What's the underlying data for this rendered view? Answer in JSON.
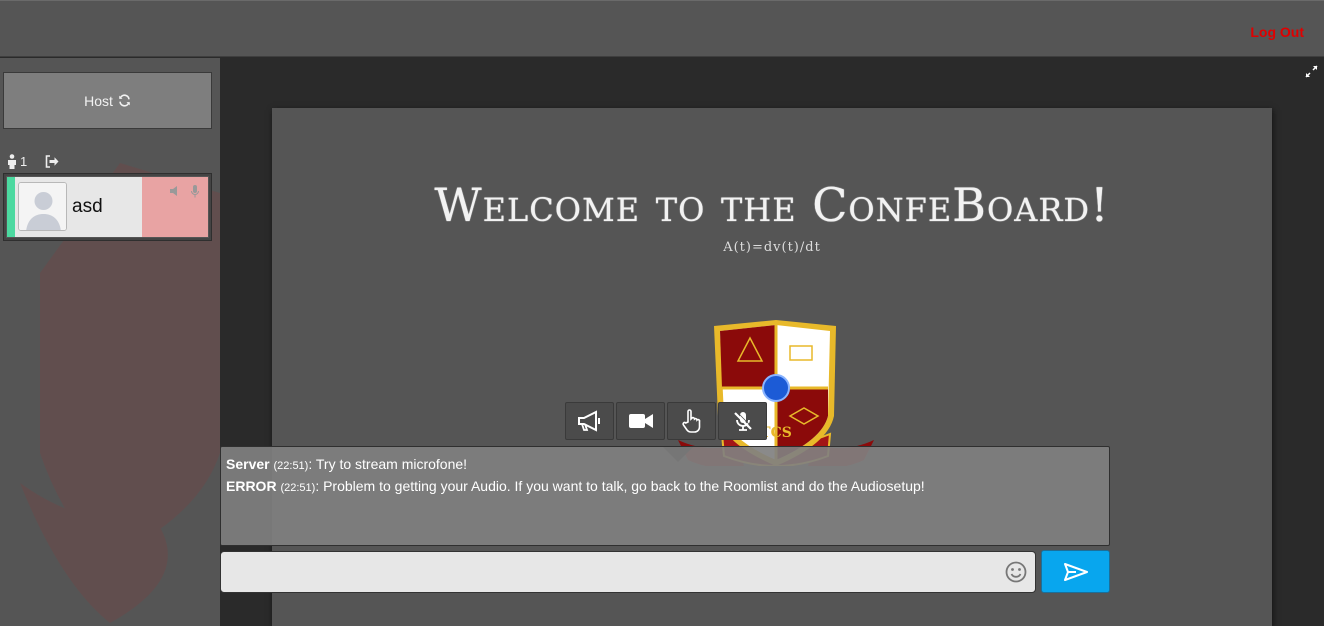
{
  "header": {
    "logout_label": "Log Out"
  },
  "sidebar": {
    "host_label": "Host",
    "user_count": "1",
    "users": [
      {
        "name": "asd",
        "status_color": "#4cd9a0",
        "media_color": "#e8a3a3"
      }
    ]
  },
  "board": {
    "title": "Welcome to the ConfeBoard!",
    "subtitle": "A(t)=dv(t)/dt",
    "logo_text": "TCS"
  },
  "toolbar": {
    "items": [
      "megaphone-icon",
      "video-camera-icon",
      "hand-pointer-icon",
      "microphone-muted-icon"
    ]
  },
  "chat": {
    "messages": [
      {
        "sender": "Server",
        "time": "(22:51)",
        "text": ": Try to stream microfone!"
      },
      {
        "sender": "ERROR",
        "time": "(22:51)",
        "text": ": Problem to getting your Audio. If you want to talk, go back to the Roomlist and do the Audiosetup!"
      }
    ],
    "input_placeholder": "",
    "input_value": ""
  },
  "colors": {
    "logout": "#e00000",
    "send_button": "#08a6ee",
    "user_online": "#4cd9a0",
    "crest_red": "#8b0a0a",
    "crest_gold": "#e8b92a"
  }
}
